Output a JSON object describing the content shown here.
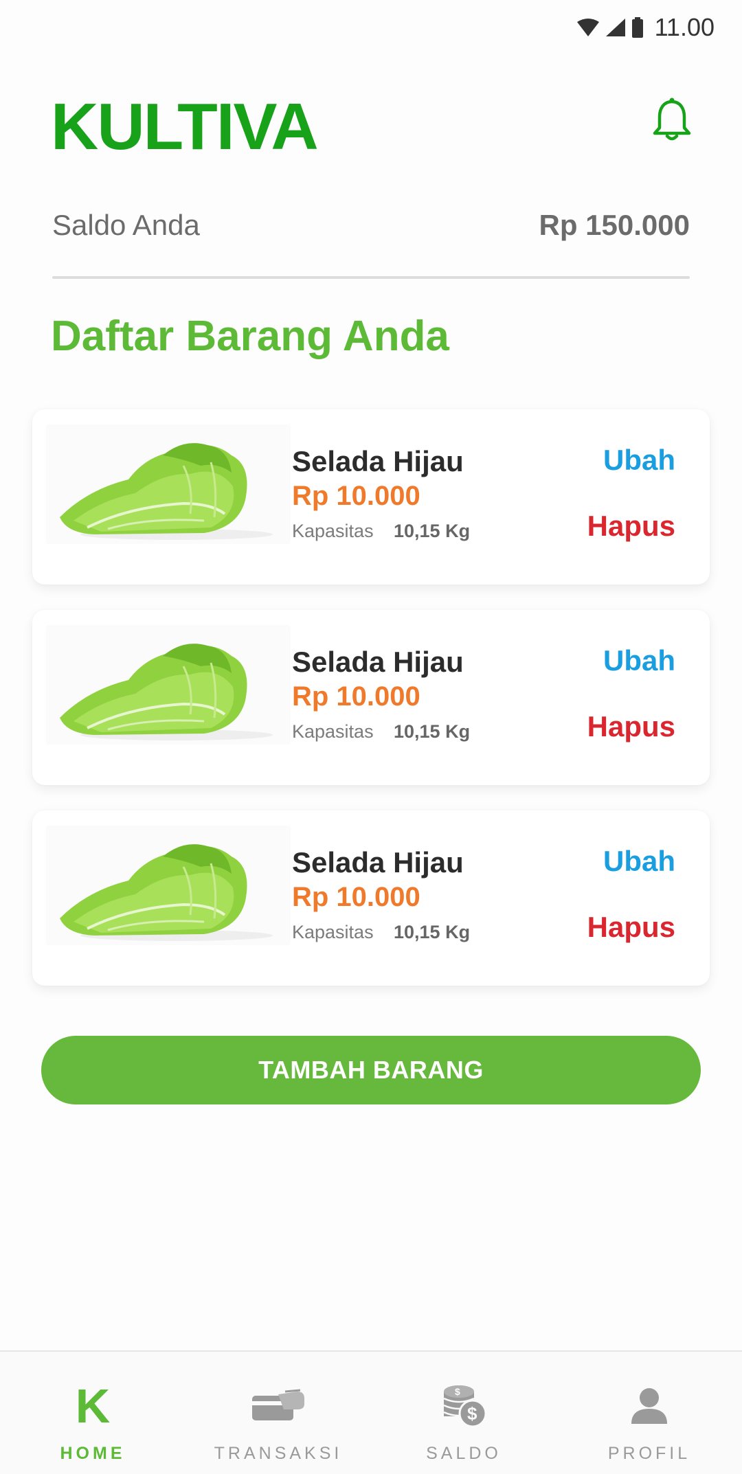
{
  "status_bar": {
    "time": "11.00"
  },
  "header": {
    "title": "KULTIVA"
  },
  "balance": {
    "label": "Saldo Anda",
    "value": "Rp 150.000"
  },
  "section_title": "Daftar Barang Anda",
  "products": [
    {
      "name": "Selada Hijau",
      "price": "Rp 10.000",
      "capacity_label": "Kapasitas",
      "capacity_value": "10,15 Kg",
      "edit_label": "Ubah",
      "delete_label": "Hapus"
    },
    {
      "name": "Selada Hijau",
      "price": "Rp 10.000",
      "capacity_label": "Kapasitas",
      "capacity_value": "10,15 Kg",
      "edit_label": "Ubah",
      "delete_label": "Hapus"
    },
    {
      "name": "Selada Hijau",
      "price": "Rp 10.000",
      "capacity_label": "Kapasitas",
      "capacity_value": "10,15 Kg",
      "edit_label": "Ubah",
      "delete_label": "Hapus"
    }
  ],
  "add_button_label": "TAMBAH BARANG",
  "nav": {
    "items": [
      {
        "label": "HOME",
        "icon": "k-logo-icon",
        "active": true
      },
      {
        "label": "TRANSAKSI",
        "icon": "wallet-icon",
        "active": false
      },
      {
        "label": "SALDO",
        "icon": "coins-icon",
        "active": false
      },
      {
        "label": "PROFIL",
        "icon": "user-icon",
        "active": false
      }
    ]
  },
  "colors": {
    "brand_green": "#18a21a",
    "accent_green": "#5dba37",
    "price_orange": "#ef7a2b",
    "edit_blue": "#1a9ee0",
    "delete_red": "#d9262f"
  }
}
